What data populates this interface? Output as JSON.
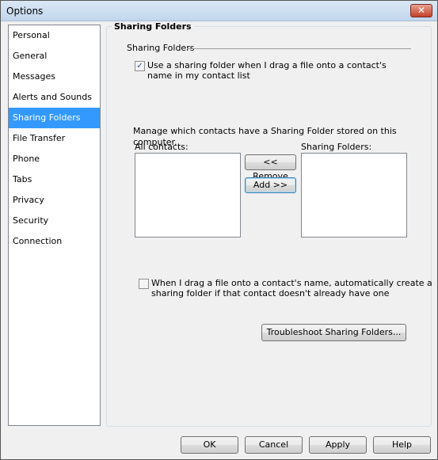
{
  "window": {
    "title": "Options",
    "close_glyph": "✕"
  },
  "sidebar": {
    "items": [
      {
        "label": "Personal"
      },
      {
        "label": "General"
      },
      {
        "label": "Messages"
      },
      {
        "label": "Alerts and Sounds"
      },
      {
        "label": "Sharing Folders",
        "selected": true
      },
      {
        "label": "File Transfer"
      },
      {
        "label": "Phone"
      },
      {
        "label": "Tabs"
      },
      {
        "label": "Privacy"
      },
      {
        "label": "Security"
      },
      {
        "label": "Connection"
      }
    ]
  },
  "panel": {
    "title": "Sharing Folders",
    "group_label": "Sharing Folders",
    "use_sharing_checkbox": {
      "label_line1": "Use a sharing folder when I drag a file onto a contact's",
      "label_line2": "name in my contact list",
      "checked": true,
      "glyph": "✓"
    },
    "manage_text": "Manage which contacts have a Sharing Folder stored on this computer.",
    "all_contacts_label": "All contacts:",
    "sharing_folders_label": "Sharing Folders:",
    "remove_button": "<< Remove",
    "add_button": "Add >>",
    "auto_create_checkbox": {
      "label_line1": "When I drag a file onto a contact's name, automatically create a",
      "label_line2": "sharing folder if that contact doesn't already have one",
      "checked": false
    },
    "troubleshoot_button": "Troubleshoot Sharing Folders..."
  },
  "footer": {
    "ok": "OK",
    "cancel": "Cancel",
    "apply": "Apply",
    "help": "Help"
  }
}
